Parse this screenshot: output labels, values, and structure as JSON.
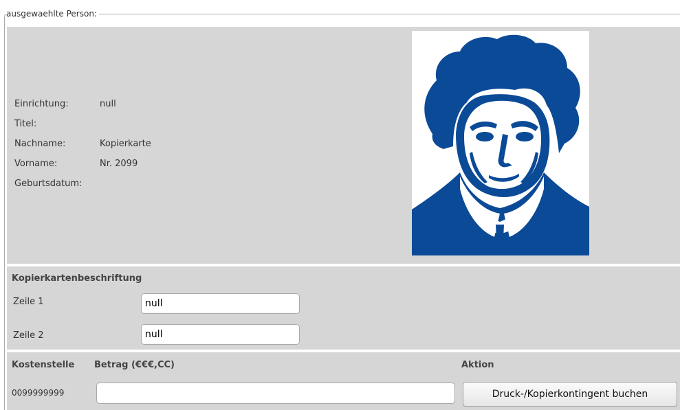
{
  "legend": "ausgewaehlte Person:",
  "person": {
    "einrichtung_label": "Einrichtung:",
    "einrichtung_value": "null",
    "titel_label": "Titel:",
    "titel_value": "",
    "nachname_label": "Nachname:",
    "nachname_value": "Kopierkarte",
    "vorname_label": "Vorname:",
    "vorname_value": "Nr. 2099",
    "geburtsdatum_label": "Geburtsdatum:",
    "geburtsdatum_value": "",
    "portrait_icon": "goethe-portrait-logo",
    "portrait_color": "#0b4a96"
  },
  "card_label": {
    "title": "Kopierkartenbeschriftung",
    "line1_label": "Zeile 1",
    "line1_value": "null",
    "line2_label": "Zeile 2",
    "line2_value": "null"
  },
  "cost": {
    "kostenstelle_header": "Kostenstelle",
    "betrag_header": "Betrag (€€€,CC)",
    "aktion_header": "Aktion",
    "kostenstelle_value": "0099999999",
    "betrag_value": "",
    "button_label": "Druck-/Kopierkontingent buchen"
  },
  "colors": {
    "panel_bg": "#d6d6d6",
    "logo_blue": "#0b4a96"
  }
}
